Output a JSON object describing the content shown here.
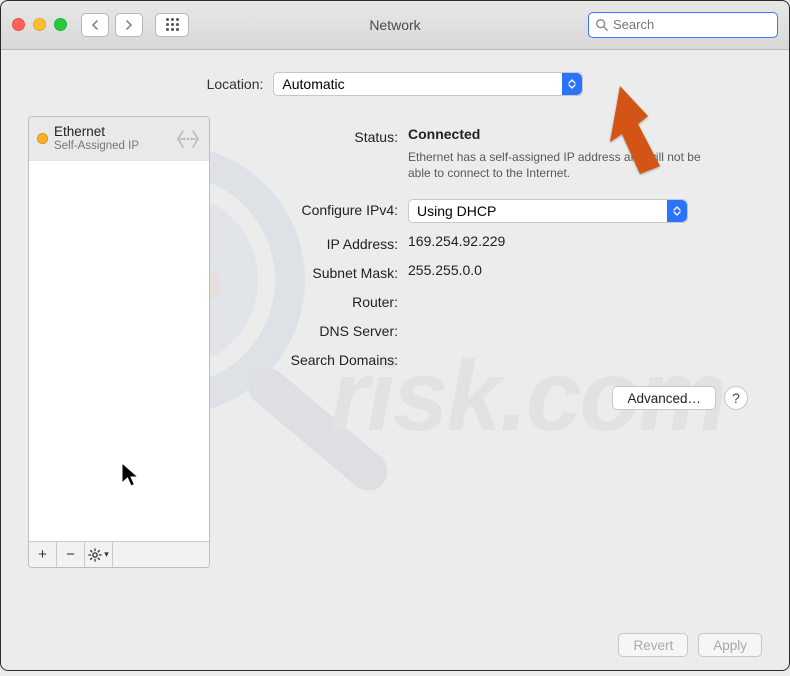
{
  "window": {
    "title": "Network"
  },
  "toolbar": {
    "search_placeholder": "Search"
  },
  "location": {
    "label": "Location:",
    "value": "Automatic"
  },
  "sidebar": {
    "services": [
      {
        "name": "Ethernet",
        "status": "Self-Assigned IP",
        "dot_color": "#ffb020"
      }
    ],
    "tools": {
      "add": "+",
      "remove": "−"
    }
  },
  "details": {
    "status_label": "Status:",
    "status_value": "Connected",
    "status_desc": "Ethernet has a self-assigned IP address and will not be able to connect to the Internet.",
    "configure_label": "Configure IPv4:",
    "configure_value": "Using DHCP",
    "ip_label": "IP Address:",
    "ip_value": "169.254.92.229",
    "mask_label": "Subnet Mask:",
    "mask_value": "255.255.0.0",
    "router_label": "Router:",
    "router_value": "",
    "dns_label": "DNS Server:",
    "dns_value": "",
    "search_label": "Search Domains:",
    "search_value": ""
  },
  "buttons": {
    "advanced": "Advanced…",
    "help": "?",
    "revert": "Revert",
    "apply": "Apply"
  }
}
